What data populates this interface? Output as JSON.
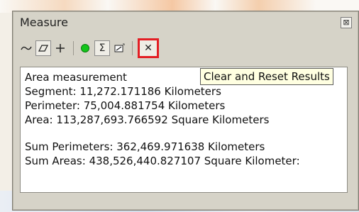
{
  "window": {
    "title": "Measure",
    "close_glyph": "⊠"
  },
  "toolbar": {
    "tools": [
      {
        "icon": "measure-line-icon",
        "glyph": "⌒"
      },
      {
        "icon": "measure-area-icon",
        "glyph": "▱"
      },
      {
        "icon": "measure-feature-icon",
        "glyph": "+"
      },
      {
        "icon": "snapping-icon",
        "glyph": "●"
      },
      {
        "icon": "show-total-icon",
        "glyph": "Σ"
      },
      {
        "icon": "choose-units-icon",
        "glyph": "▤"
      },
      {
        "icon": "clear-reset-icon",
        "glyph": "✕"
      }
    ],
    "accent_dot": "#13c51b",
    "highlight_color": "#e31e24"
  },
  "results": {
    "heading": "Area measurement",
    "segment": "Segment: 11,272.171186 Kilometers",
    "perimeter": "Perimeter: 75,004.881754 Kilometers",
    "area": "Area: 113,287,693.766592 Square Kilometers",
    "sum_perimeters": "Sum Perimeters: 362,469.971638 Kilometers",
    "sum_areas": "Sum Areas: 438,526,440.827107 Square Kilometer:"
  },
  "tooltip": {
    "text": "Clear and Reset Results"
  }
}
